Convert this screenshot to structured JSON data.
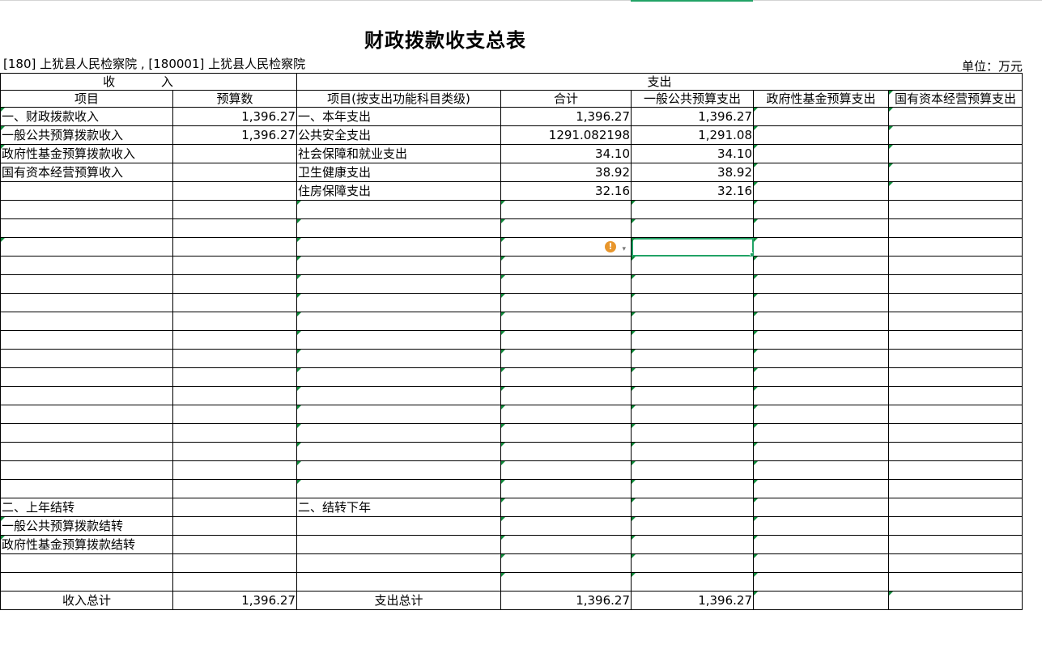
{
  "title": "财政拨款收支总表",
  "subtitle": "[180] 上犹县人民检察院 , [180001] 上犹县人民检察院",
  "unit": "单位：万元",
  "header": {
    "income_group": "收 入",
    "expense_group": "支出",
    "col_item": "项目",
    "col_budget": "预算数",
    "col_expense_item": "项目(按支出功能科目类级)",
    "col_total": "合计",
    "col_general": "一般公共预算支出",
    "col_fund": "政府性基金预算支出",
    "col_state": "国有资本经营预算支出"
  },
  "rows": [
    {
      "in_item": "一、财政拨款收入",
      "in_amount": "1,396.27",
      "ex_item": "一、本年支出",
      "total": "1,396.27",
      "general": "1,396.27"
    },
    {
      "in_item": "一般公共预算拨款收入",
      "in_amount": "1,396.27",
      "ex_item": "公共安全支出",
      "total": "1291.082198",
      "general": "1,291.08"
    },
    {
      "in_item": "政府性基金预算拨款收入",
      "in_amount": "",
      "ex_item": "社会保障和就业支出",
      "total": "34.10",
      "general": "34.10"
    },
    {
      "in_item": "国有资本经营预算收入",
      "in_amount": "",
      "ex_item": "卫生健康支出",
      "total": "38.92",
      "general": "38.92"
    },
    {
      "in_item": "",
      "in_amount": "",
      "ex_item": "住房保障支出",
      "total": "32.16",
      "general": "32.16"
    }
  ],
  "carry": [
    {
      "in_item": "二、上年结转",
      "ex_item": "二、结转下年"
    },
    {
      "in_item": "一般公共预算拨款结转",
      "ex_item": ""
    },
    {
      "in_item": "政府性基金预算拨款结转",
      "ex_item": ""
    }
  ],
  "totals": {
    "in_label": "收入总计",
    "in_amount": "1,396.27",
    "ex_label": "支出总计",
    "total": "1,396.27",
    "general": "1,396.27"
  },
  "warning_icon": "exclamation-icon",
  "accent_color": "#21a366"
}
